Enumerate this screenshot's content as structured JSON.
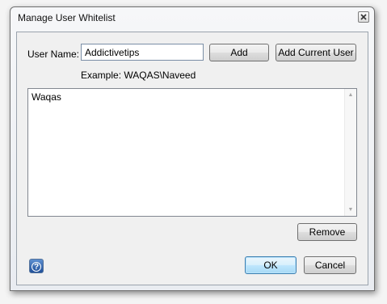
{
  "window": {
    "title": "Manage User Whitelist",
    "close_symbol": "×"
  },
  "form": {
    "user_name_label": "User Name:",
    "user_name_value": "Addictivetips",
    "add_label": "Add",
    "add_current_label": "Add Current User",
    "example_text": "Example: WAQAS\\Naveed"
  },
  "whitelist": {
    "items": [
      "Waqas"
    ]
  },
  "buttons": {
    "remove_label": "Remove",
    "ok_label": "OK",
    "cancel_label": "Cancel",
    "help_symbol": "?"
  },
  "icons": {
    "close": "close-icon",
    "help": "help-icon",
    "scroll_up": "scroll-up-arrow-icon",
    "scroll_down": "scroll-down-arrow-icon"
  }
}
